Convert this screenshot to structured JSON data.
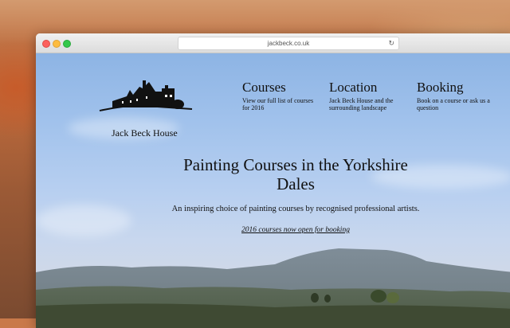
{
  "browser": {
    "url": "jackbeck.co.uk"
  },
  "brand": {
    "name": "Jack Beck House"
  },
  "nav": [
    {
      "title": "Courses",
      "desc": "View our full list of courses for 2016"
    },
    {
      "title": "Location",
      "desc": "Jack Beck House and the surrounding landscape"
    },
    {
      "title": "Booking",
      "desc": "Book on a course or ask us a question"
    }
  ],
  "hero": {
    "title": "Painting Courses in the Yorkshire Dales",
    "subtitle": "An inspiring choice of painting courses by recognised professional artists.",
    "link": "2016 courses now open for booking"
  },
  "icons": {
    "reload": "reload-icon",
    "logo": "house-logo-icon"
  },
  "colors": {
    "close": "#fc605c",
    "minimize": "#fdbc40",
    "zoom": "#34c84a"
  }
}
